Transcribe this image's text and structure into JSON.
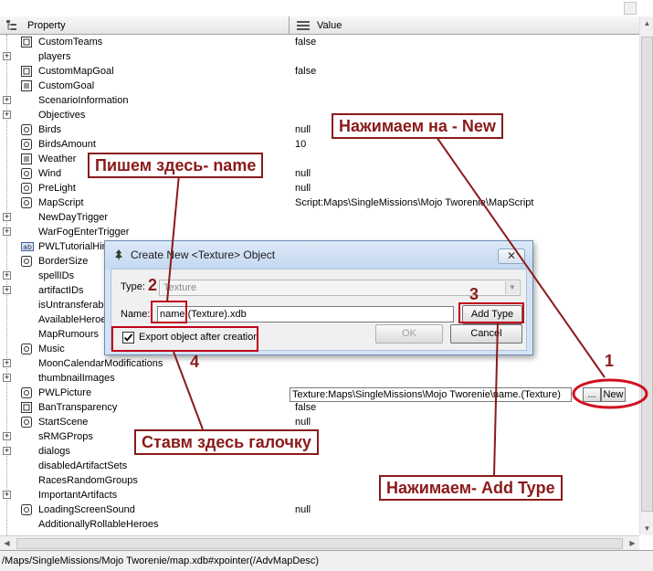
{
  "header": {
    "property": "Property",
    "value": "Value"
  },
  "rows": [
    {
      "label": "CustomTeams",
      "value": "false",
      "exp": false,
      "icon": "struct"
    },
    {
      "label": "players",
      "value": "",
      "exp": true,
      "icon": "none"
    },
    {
      "label": "CustomMapGoal",
      "value": "false",
      "exp": false,
      "icon": "struct"
    },
    {
      "label": "CustomGoal",
      "value": "",
      "exp": false,
      "icon": "list"
    },
    {
      "label": "ScenarioInformation",
      "value": "",
      "exp": true,
      "icon": "none"
    },
    {
      "label": "Objectives",
      "value": "",
      "exp": true,
      "icon": "none"
    },
    {
      "label": "Birds",
      "value": "null",
      "exp": false,
      "icon": "link"
    },
    {
      "label": "BirdsAmount",
      "value": "10",
      "exp": false,
      "icon": "link"
    },
    {
      "label": "Weather",
      "value": "",
      "exp": false,
      "icon": "list"
    },
    {
      "label": "Wind",
      "value": "null",
      "exp": false,
      "icon": "link"
    },
    {
      "label": "PreLight",
      "value": "null",
      "exp": false,
      "icon": "link"
    },
    {
      "label": "MapScript",
      "value": "Script:Maps\\SingleMissions\\Mojo Tworenie\\MapScript",
      "exp": false,
      "icon": "link"
    },
    {
      "label": "NewDayTrigger",
      "value": "",
      "exp": true,
      "icon": "none"
    },
    {
      "label": "WarFogEnterTrigger",
      "value": "",
      "exp": true,
      "icon": "none"
    },
    {
      "label": "PWLTutorialHint",
      "value": "",
      "exp": false,
      "icon": "ab"
    },
    {
      "label": "BorderSize",
      "value": "",
      "exp": false,
      "icon": "link"
    },
    {
      "label": "spellIDs",
      "value": "",
      "exp": true,
      "icon": "none"
    },
    {
      "label": "artifactIDs",
      "value": "",
      "exp": true,
      "icon": "none"
    },
    {
      "label": "isUntransferable",
      "value": "",
      "exp": false,
      "icon": "none"
    },
    {
      "label": "AvailableHeroes",
      "value": "",
      "exp": false,
      "icon": "none"
    },
    {
      "label": "MapRumours",
      "value": "",
      "exp": false,
      "icon": "none"
    },
    {
      "label": "Music",
      "value": "",
      "exp": false,
      "icon": "link"
    },
    {
      "label": "MoonCalendarModifications",
      "value": "",
      "exp": true,
      "icon": "none"
    },
    {
      "label": "thumbnailImages",
      "value": "",
      "exp": true,
      "icon": "none"
    },
    {
      "label": "PWLPicture",
      "value": "",
      "exp": false,
      "icon": "link"
    },
    {
      "label": "BanTransparency",
      "value": "false",
      "exp": false,
      "icon": "struct"
    },
    {
      "label": "StartScene",
      "value": "null",
      "exp": false,
      "icon": "link"
    },
    {
      "label": "sRMGProps",
      "value": "",
      "exp": true,
      "icon": "none"
    },
    {
      "label": "dialogs",
      "value": "",
      "exp": true,
      "icon": "none"
    },
    {
      "label": "disabledArtifactSets",
      "value": "",
      "exp": false,
      "icon": "none"
    },
    {
      "label": "RacesRandomGroups",
      "value": "",
      "exp": false,
      "icon": "none"
    },
    {
      "label": "ImportantArtifacts",
      "value": "",
      "exp": true,
      "icon": "none"
    },
    {
      "label": "LoadingScreenSound",
      "value": "null",
      "exp": false,
      "icon": "link"
    },
    {
      "label": "AdditionallyRollableHeroes",
      "value": "",
      "exp": false,
      "icon": "none"
    }
  ],
  "pwl_picture": {
    "value": "Texture:Maps\\SingleMissions\\Mojo Tworenie\\name.(Texture)",
    "browse": "...",
    "new": "New"
  },
  "status_bar": "/Maps/SingleMissions/Mojo Tworenie/map.xdb#xpointer(/AdvMapDesc)",
  "dialog": {
    "title": "Create New <Texture> Object",
    "type_label": "Type:",
    "type_value": "Texture",
    "name_label": "Name:",
    "name_value": "name.(Texture).xdb",
    "add_type": "Add Type",
    "ok": "OK",
    "cancel": "Cancel",
    "export_label": "Export object after creation",
    "export_checked": true
  },
  "annotations": {
    "click_new": "Нажимаем на - New",
    "write_name": "Пишем здесь- name",
    "tick_here": "Ставм здесь галочку",
    "click_add_type": "Нажимаем- Add Type",
    "n1": "1",
    "n2": "2",
    "n3": "3",
    "n4": "4"
  },
  "colors": {
    "annotation": "#8b1a1a",
    "highlight": "#c0001a"
  }
}
